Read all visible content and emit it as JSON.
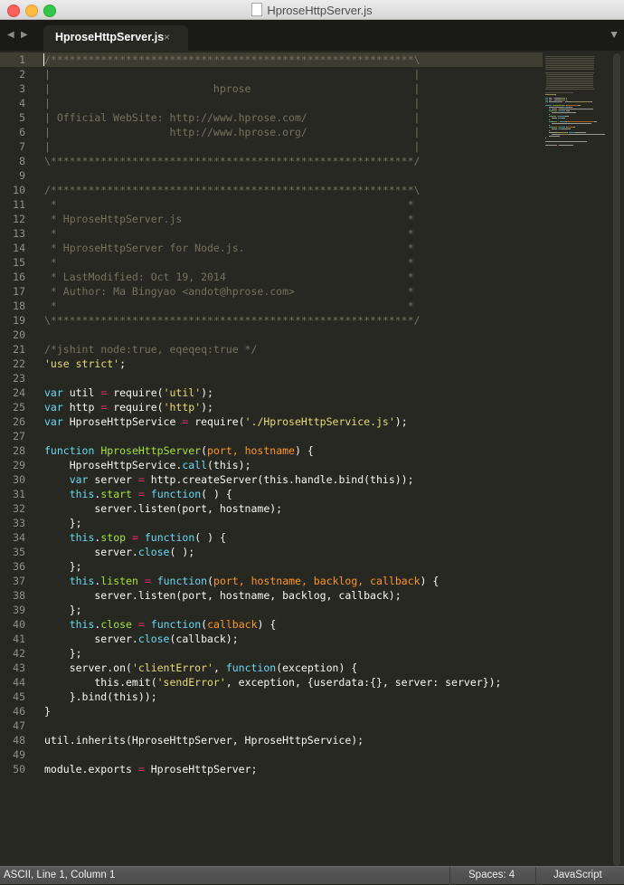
{
  "window": {
    "title": "HproseHttpServer.js"
  },
  "tabs": [
    {
      "label": "HproseHttpServer.js",
      "close": "×",
      "active": true
    }
  ],
  "nav": {
    "back": "◀",
    "forward": "▶",
    "menu": "▼"
  },
  "colors": {
    "background": "#272822",
    "comment": "#75715e",
    "string": "#e6db74",
    "keyword": "#66d9ef",
    "operator": "#f92672",
    "function": "#a6e22e",
    "parameter": "#fd971f",
    "text": "#f8f8f2"
  },
  "editor": {
    "cursor": {
      "line": 1,
      "column": 1
    },
    "lines": [
      [
        [
          "c",
          "/**********************************************************\\"
        ]
      ],
      [
        [
          "c",
          "|                                                          |"
        ]
      ],
      [
        [
          "c",
          "|                          hprose                          |"
        ]
      ],
      [
        [
          "c",
          "|                                                          |"
        ]
      ],
      [
        [
          "c",
          "| Official WebSite: http://www.hprose.com/                 |"
        ]
      ],
      [
        [
          "c",
          "|                   http://www.hprose.org/                 |"
        ]
      ],
      [
        [
          "c",
          "|                                                          |"
        ]
      ],
      [
        [
          "c",
          "\\**********************************************************/"
        ]
      ],
      [],
      [
        [
          "c",
          "/**********************************************************\\"
        ]
      ],
      [
        [
          "c",
          " *                                                        *"
        ]
      ],
      [
        [
          "c",
          " * HproseHttpServer.js                                    *"
        ]
      ],
      [
        [
          "c",
          " *                                                        *"
        ]
      ],
      [
        [
          "c",
          " * HproseHttpServer for Node.js.                          *"
        ]
      ],
      [
        [
          "c",
          " *                                                        *"
        ]
      ],
      [
        [
          "c",
          " * LastModified: Oct 19, 2014                             *"
        ]
      ],
      [
        [
          "c",
          " * Author: Ma Bingyao <andot@hprose.com>                  *"
        ]
      ],
      [
        [
          "c",
          " *                                                        *"
        ]
      ],
      [
        [
          "c",
          "\\**********************************************************/"
        ]
      ],
      [],
      [
        [
          "c",
          "/*jshint node:true, eqeqeq:true */"
        ]
      ],
      [
        [
          "s",
          "'use strict'"
        ],
        [
          "t",
          ";"
        ]
      ],
      [],
      [
        [
          "k",
          "var"
        ],
        [
          "t",
          " util "
        ],
        [
          "op",
          "="
        ],
        [
          "t",
          " require("
        ],
        [
          "s",
          "'util'"
        ],
        [
          "t",
          ");"
        ]
      ],
      [
        [
          "k",
          "var"
        ],
        [
          "t",
          " http "
        ],
        [
          "op",
          "="
        ],
        [
          "t",
          " require("
        ],
        [
          "s",
          "'http'"
        ],
        [
          "t",
          ");"
        ]
      ],
      [
        [
          "k",
          "var"
        ],
        [
          "t",
          " HproseHttpService "
        ],
        [
          "op",
          "="
        ],
        [
          "t",
          " require("
        ],
        [
          "s",
          "'./HproseHttpService.js'"
        ],
        [
          "t",
          ");"
        ]
      ],
      [],
      [
        [
          "k",
          "function"
        ],
        [
          "t",
          " "
        ],
        [
          "fn",
          "HproseHttpServer"
        ],
        [
          "t",
          "("
        ],
        [
          "p",
          "port, hostname"
        ],
        [
          "t",
          ") {"
        ]
      ],
      [
        [
          "t",
          "    HproseHttpService."
        ],
        [
          "k",
          "call"
        ],
        [
          "t",
          "(this);"
        ]
      ],
      [
        [
          "t",
          "    "
        ],
        [
          "k",
          "var"
        ],
        [
          "t",
          " server "
        ],
        [
          "op",
          "="
        ],
        [
          "t",
          " http.createServer(this.handle.bind(this));"
        ]
      ],
      [
        [
          "t",
          "    "
        ],
        [
          "k",
          "this"
        ],
        [
          "t",
          "."
        ],
        [
          "fn",
          "start"
        ],
        [
          "t",
          " "
        ],
        [
          "op",
          "="
        ],
        [
          "t",
          " "
        ],
        [
          "k",
          "function"
        ],
        [
          "t",
          "( ) {"
        ]
      ],
      [
        [
          "t",
          "        server.listen(port, hostname);"
        ]
      ],
      [
        [
          "t",
          "    };"
        ]
      ],
      [
        [
          "t",
          "    "
        ],
        [
          "k",
          "this"
        ],
        [
          "t",
          "."
        ],
        [
          "fn",
          "stop"
        ],
        [
          "t",
          " "
        ],
        [
          "op",
          "="
        ],
        [
          "t",
          " "
        ],
        [
          "k",
          "function"
        ],
        [
          "t",
          "( ) {"
        ]
      ],
      [
        [
          "t",
          "        server."
        ],
        [
          "k",
          "close"
        ],
        [
          "t",
          "( );"
        ]
      ],
      [
        [
          "t",
          "    };"
        ]
      ],
      [
        [
          "t",
          "    "
        ],
        [
          "k",
          "this"
        ],
        [
          "t",
          "."
        ],
        [
          "fn",
          "listen"
        ],
        [
          "t",
          " "
        ],
        [
          "op",
          "="
        ],
        [
          "t",
          " "
        ],
        [
          "k",
          "function"
        ],
        [
          "t",
          "("
        ],
        [
          "p",
          "port, hostname, backlog, callback"
        ],
        [
          "t",
          ") {"
        ]
      ],
      [
        [
          "t",
          "        server.listen(port, hostname, backlog, callback);"
        ]
      ],
      [
        [
          "t",
          "    };"
        ]
      ],
      [
        [
          "t",
          "    "
        ],
        [
          "k",
          "this"
        ],
        [
          "t",
          "."
        ],
        [
          "fn",
          "close"
        ],
        [
          "t",
          " "
        ],
        [
          "op",
          "="
        ],
        [
          "t",
          " "
        ],
        [
          "k",
          "function"
        ],
        [
          "t",
          "("
        ],
        [
          "p",
          "callback"
        ],
        [
          "t",
          ") {"
        ]
      ],
      [
        [
          "t",
          "        server."
        ],
        [
          "k",
          "close"
        ],
        [
          "t",
          "(callback);"
        ]
      ],
      [
        [
          "t",
          "    };"
        ]
      ],
      [
        [
          "t",
          "    server.on("
        ],
        [
          "s",
          "'clientError'"
        ],
        [
          "t",
          ", "
        ],
        [
          "k",
          "function"
        ],
        [
          "t",
          "(exception) {"
        ]
      ],
      [
        [
          "t",
          "        this.emit("
        ],
        [
          "s",
          "'sendError'"
        ],
        [
          "t",
          ", exception, {userdata:{}, server: server});"
        ]
      ],
      [
        [
          "t",
          "    }.bind(this));"
        ]
      ],
      [
        [
          "t",
          "}"
        ]
      ],
      [],
      [
        [
          "t",
          "util.inherits(HproseHttpServer, HproseHttpService);"
        ]
      ],
      [],
      [
        [
          "t",
          "module.exports "
        ],
        [
          "op",
          "="
        ],
        [
          "t",
          " HproseHttpServer;"
        ]
      ]
    ]
  },
  "status": {
    "position": "ASCII, Line 1, Column 1",
    "indentation": "Spaces: 4",
    "syntax": "JavaScript"
  }
}
